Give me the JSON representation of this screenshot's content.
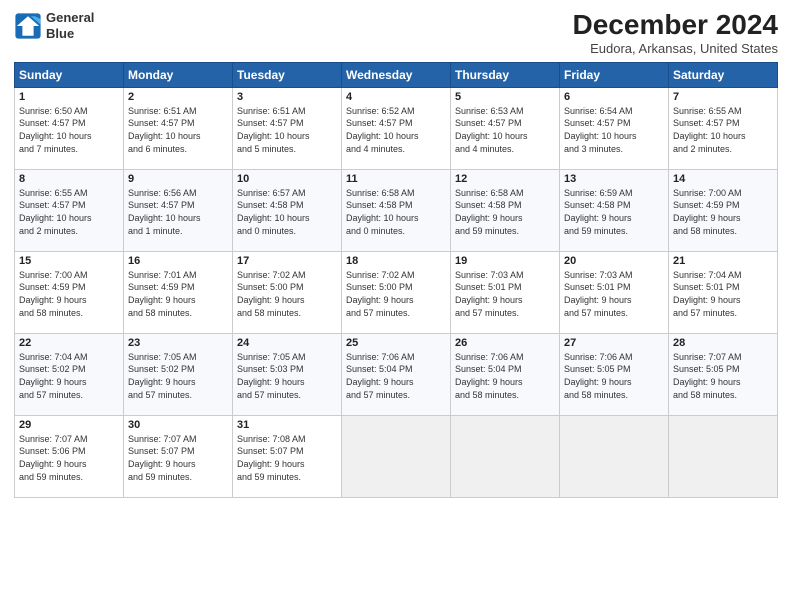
{
  "header": {
    "logo_line1": "General",
    "logo_line2": "Blue",
    "title": "December 2024",
    "location": "Eudora, Arkansas, United States"
  },
  "days_of_week": [
    "Sunday",
    "Monday",
    "Tuesday",
    "Wednesday",
    "Thursday",
    "Friday",
    "Saturday"
  ],
  "weeks": [
    [
      {
        "day": 1,
        "info": "Sunrise: 6:50 AM\nSunset: 4:57 PM\nDaylight: 10 hours\nand 7 minutes."
      },
      {
        "day": 2,
        "info": "Sunrise: 6:51 AM\nSunset: 4:57 PM\nDaylight: 10 hours\nand 6 minutes."
      },
      {
        "day": 3,
        "info": "Sunrise: 6:51 AM\nSunset: 4:57 PM\nDaylight: 10 hours\nand 5 minutes."
      },
      {
        "day": 4,
        "info": "Sunrise: 6:52 AM\nSunset: 4:57 PM\nDaylight: 10 hours\nand 4 minutes."
      },
      {
        "day": 5,
        "info": "Sunrise: 6:53 AM\nSunset: 4:57 PM\nDaylight: 10 hours\nand 4 minutes."
      },
      {
        "day": 6,
        "info": "Sunrise: 6:54 AM\nSunset: 4:57 PM\nDaylight: 10 hours\nand 3 minutes."
      },
      {
        "day": 7,
        "info": "Sunrise: 6:55 AM\nSunset: 4:57 PM\nDaylight: 10 hours\nand 2 minutes."
      }
    ],
    [
      {
        "day": 8,
        "info": "Sunrise: 6:55 AM\nSunset: 4:57 PM\nDaylight: 10 hours\nand 2 minutes."
      },
      {
        "day": 9,
        "info": "Sunrise: 6:56 AM\nSunset: 4:57 PM\nDaylight: 10 hours\nand 1 minute."
      },
      {
        "day": 10,
        "info": "Sunrise: 6:57 AM\nSunset: 4:58 PM\nDaylight: 10 hours\nand 0 minutes."
      },
      {
        "day": 11,
        "info": "Sunrise: 6:58 AM\nSunset: 4:58 PM\nDaylight: 10 hours\nand 0 minutes."
      },
      {
        "day": 12,
        "info": "Sunrise: 6:58 AM\nSunset: 4:58 PM\nDaylight: 9 hours\nand 59 minutes."
      },
      {
        "day": 13,
        "info": "Sunrise: 6:59 AM\nSunset: 4:58 PM\nDaylight: 9 hours\nand 59 minutes."
      },
      {
        "day": 14,
        "info": "Sunrise: 7:00 AM\nSunset: 4:59 PM\nDaylight: 9 hours\nand 58 minutes."
      }
    ],
    [
      {
        "day": 15,
        "info": "Sunrise: 7:00 AM\nSunset: 4:59 PM\nDaylight: 9 hours\nand 58 minutes."
      },
      {
        "day": 16,
        "info": "Sunrise: 7:01 AM\nSunset: 4:59 PM\nDaylight: 9 hours\nand 58 minutes."
      },
      {
        "day": 17,
        "info": "Sunrise: 7:02 AM\nSunset: 5:00 PM\nDaylight: 9 hours\nand 58 minutes."
      },
      {
        "day": 18,
        "info": "Sunrise: 7:02 AM\nSunset: 5:00 PM\nDaylight: 9 hours\nand 57 minutes."
      },
      {
        "day": 19,
        "info": "Sunrise: 7:03 AM\nSunset: 5:01 PM\nDaylight: 9 hours\nand 57 minutes."
      },
      {
        "day": 20,
        "info": "Sunrise: 7:03 AM\nSunset: 5:01 PM\nDaylight: 9 hours\nand 57 minutes."
      },
      {
        "day": 21,
        "info": "Sunrise: 7:04 AM\nSunset: 5:01 PM\nDaylight: 9 hours\nand 57 minutes."
      }
    ],
    [
      {
        "day": 22,
        "info": "Sunrise: 7:04 AM\nSunset: 5:02 PM\nDaylight: 9 hours\nand 57 minutes."
      },
      {
        "day": 23,
        "info": "Sunrise: 7:05 AM\nSunset: 5:02 PM\nDaylight: 9 hours\nand 57 minutes."
      },
      {
        "day": 24,
        "info": "Sunrise: 7:05 AM\nSunset: 5:03 PM\nDaylight: 9 hours\nand 57 minutes."
      },
      {
        "day": 25,
        "info": "Sunrise: 7:06 AM\nSunset: 5:04 PM\nDaylight: 9 hours\nand 57 minutes."
      },
      {
        "day": 26,
        "info": "Sunrise: 7:06 AM\nSunset: 5:04 PM\nDaylight: 9 hours\nand 58 minutes."
      },
      {
        "day": 27,
        "info": "Sunrise: 7:06 AM\nSunset: 5:05 PM\nDaylight: 9 hours\nand 58 minutes."
      },
      {
        "day": 28,
        "info": "Sunrise: 7:07 AM\nSunset: 5:05 PM\nDaylight: 9 hours\nand 58 minutes."
      }
    ],
    [
      {
        "day": 29,
        "info": "Sunrise: 7:07 AM\nSunset: 5:06 PM\nDaylight: 9 hours\nand 59 minutes."
      },
      {
        "day": 30,
        "info": "Sunrise: 7:07 AM\nSunset: 5:07 PM\nDaylight: 9 hours\nand 59 minutes."
      },
      {
        "day": 31,
        "info": "Sunrise: 7:08 AM\nSunset: 5:07 PM\nDaylight: 9 hours\nand 59 minutes."
      },
      null,
      null,
      null,
      null
    ]
  ]
}
